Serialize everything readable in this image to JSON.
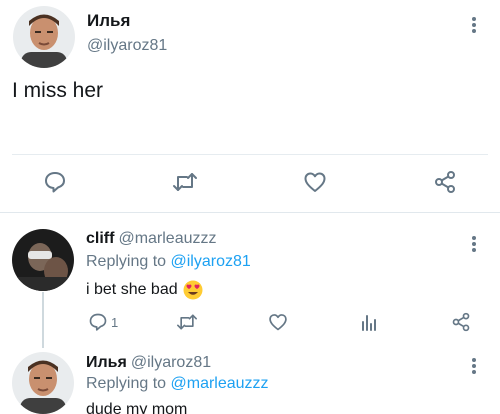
{
  "main_tweet": {
    "author_name": "Илья",
    "author_handle": "@ilyaroz81",
    "text": "I miss her"
  },
  "reply_1": {
    "author_name": "cliff",
    "author_handle": "@marleauzzz",
    "replying_prefix": "Replying to",
    "replying_to": "@ilyaroz81",
    "text": "i bet she bad",
    "emoji": "heart-eyes-emoji",
    "reply_count": "1"
  },
  "reply_2": {
    "author_name": "Илья",
    "author_handle": "@ilyaroz81",
    "replying_prefix": "Replying to",
    "replying_to": "@marleauzzz",
    "text": "dude my mom"
  },
  "icons": [
    "reply-icon",
    "retweet-icon",
    "like-icon",
    "share-icon",
    "analytics-icon",
    "more-options-icon"
  ],
  "colors": {
    "accent": "#1da1f2",
    "secondary_text": "#657786",
    "icon": "#657786",
    "divider": "#e6ecf0"
  }
}
